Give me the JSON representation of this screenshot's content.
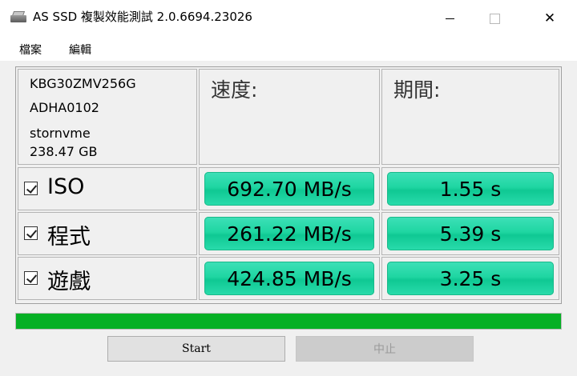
{
  "window": {
    "title": "AS SSD 複製效能測試 2.0.6694.23026",
    "close_glyph": "✕"
  },
  "menu": {
    "items": [
      "檔案",
      "編輯"
    ]
  },
  "drive": {
    "model": "KBG30ZMV256G",
    "firmware": "ADHA0102",
    "driver": "stornvme",
    "size": "238.47 GB"
  },
  "headers": {
    "speed": "速度:",
    "time": "期間:"
  },
  "rows": [
    {
      "label": "ISO",
      "checked": true,
      "speed": "692.70 MB/s",
      "time": "1.55 s"
    },
    {
      "label": "程式",
      "checked": true,
      "speed": "261.22 MB/s",
      "time": "5.39 s"
    },
    {
      "label": "遊戲",
      "checked": true,
      "speed": "424.85 MB/s",
      "time": "3.25 s"
    }
  ],
  "progress": {
    "percent": 100,
    "color": "#06b025"
  },
  "buttons": {
    "start": "Start",
    "stop": "中止"
  },
  "colors": {
    "result_green": "#1fd6a2"
  }
}
